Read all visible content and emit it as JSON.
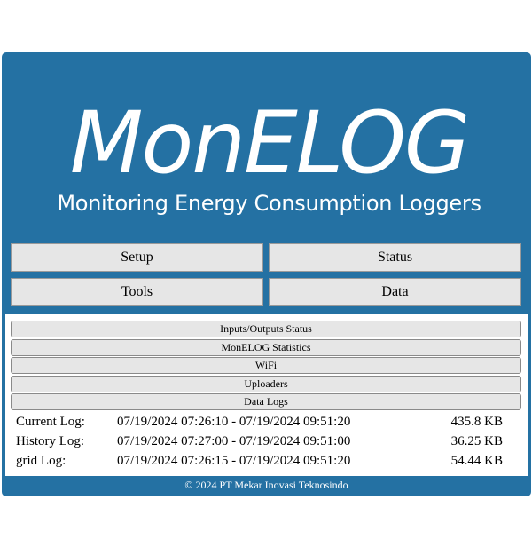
{
  "logo": {
    "title": "MonELOG",
    "subtitle": "Monitoring Energy Consumption Loggers"
  },
  "nav": {
    "setup": "Setup",
    "status": "Status",
    "tools": "Tools",
    "data": "Data"
  },
  "sections": [
    "Inputs/Outputs Status",
    "MonELOG Statistics",
    "WiFi",
    "Uploaders",
    "Data Logs"
  ],
  "logs": [
    {
      "name": "Current Log:",
      "range": "07/19/2024 07:26:10 - 07/19/2024 09:51:20",
      "size": "435.8 KB"
    },
    {
      "name": "History Log:",
      "range": "07/19/2024 07:27:00 - 07/19/2024 09:51:00",
      "size": "36.25 KB"
    },
    {
      "name": "grid Log:",
      "range": "07/19/2024 07:26:15 - 07/19/2024 09:51:20",
      "size": "54.44 KB"
    }
  ],
  "footer": "© 2024 PT Mekar Inovasi Teknosindo",
  "colors": {
    "header_bg": "#2471a3",
    "button_bg": "#e6e6e6"
  }
}
